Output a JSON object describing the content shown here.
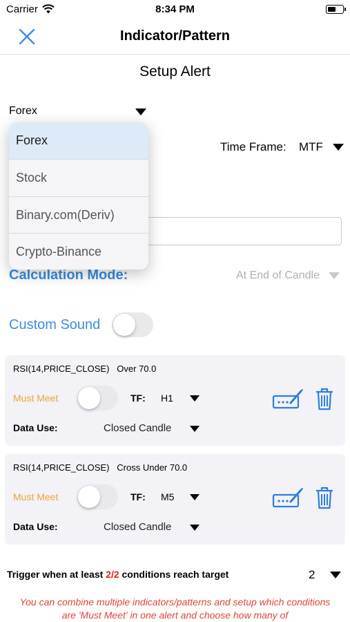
{
  "status_bar": {
    "carrier": "Carrier",
    "time": "8:34 PM"
  },
  "nav": {
    "title": "Indicator/Pattern"
  },
  "subtitle": "Setup Alert",
  "market": {
    "selected": "Forex",
    "options": [
      "Forex",
      "Stock",
      "Binary.com(Deriv)",
      "Crypto-Binance"
    ]
  },
  "time_frame": {
    "label": "Time Frame:",
    "value": "MTF"
  },
  "calculation_mode": {
    "label": "Calculation Mode:",
    "value": "At End of Candle"
  },
  "custom_sound": {
    "label": "Custom Sound",
    "on": false
  },
  "conditions": [
    {
      "indicator": "RSI(14,PRICE_CLOSE)",
      "rule": "Over 70.0",
      "must_meet_label": "Must Meet",
      "must_meet_on": false,
      "tf_label": "TF:",
      "tf_value": "H1",
      "data_use_label": "Data Use:",
      "data_use_value": "Closed Candle"
    },
    {
      "indicator": "RSI(14,PRICE_CLOSE)",
      "rule": "Cross Under 70.0",
      "must_meet_label": "Must Meet",
      "must_meet_on": false,
      "tf_label": "TF:",
      "tf_value": "M5",
      "data_use_label": "Data Use:",
      "data_use_value": "Closed Candle"
    }
  ],
  "trigger": {
    "prefix": "Trigger when at least",
    "fraction": "2/2",
    "suffix": "conditions reach target",
    "value": "2"
  },
  "note": "You can combine multiple indicators/patterns and setup which conditions are 'Must Meet' in one alert and choose how many of",
  "colors": {
    "accent_blue": "#3a8de0",
    "must_meet_orange": "#f0a23a",
    "highlight_red": "#e02020"
  }
}
